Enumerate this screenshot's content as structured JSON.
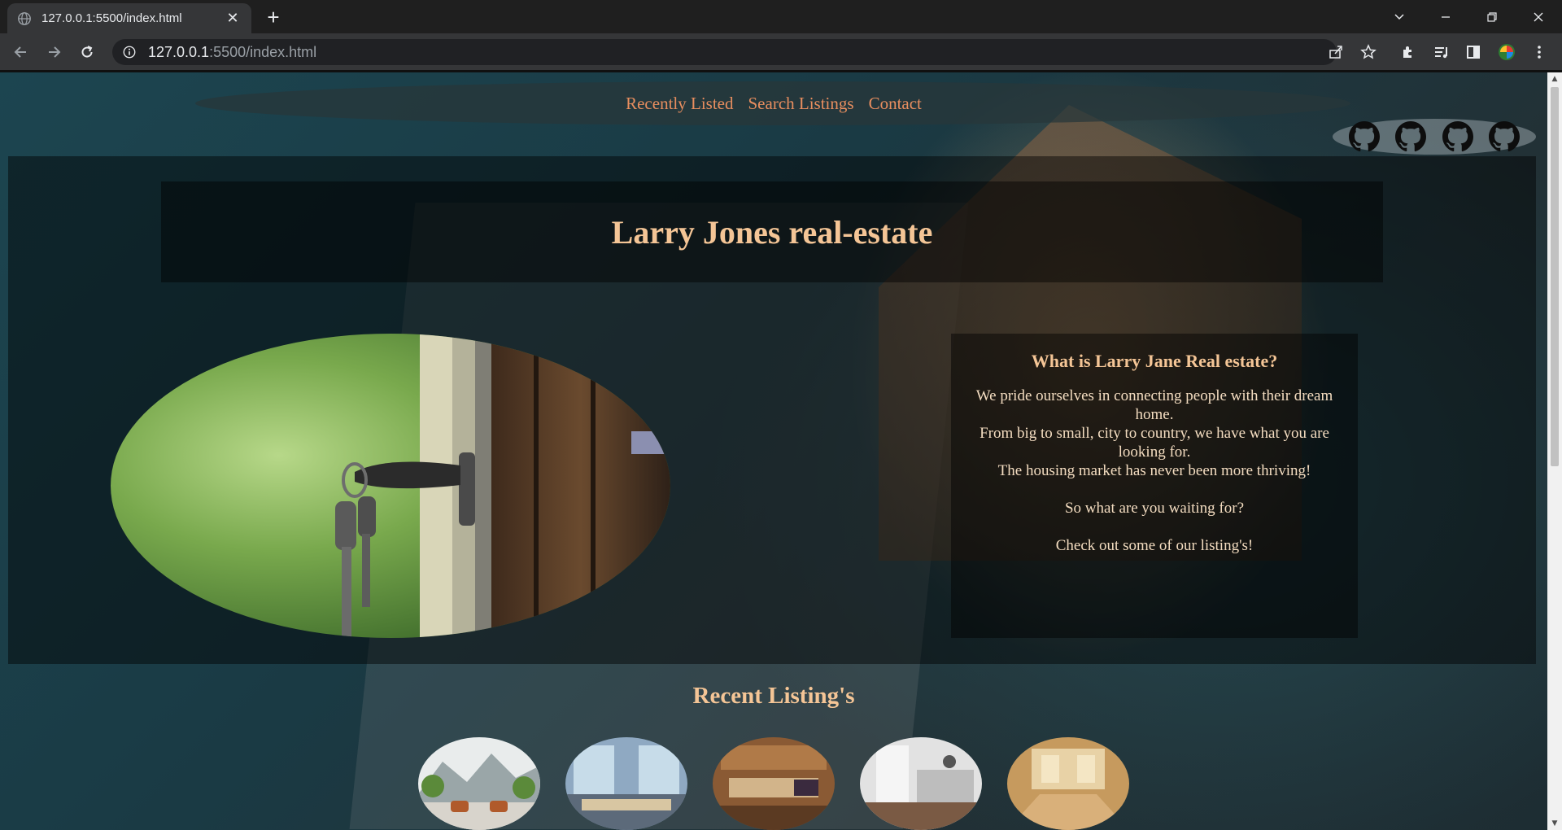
{
  "browser": {
    "tab_title": "127.0.0.1:5500/index.html",
    "url_host": "127.0.0.1",
    "url_rest": ":5500/index.html",
    "new_tab_glyph": "+",
    "close_glyph": "✕"
  },
  "nav": {
    "links": [
      "Recently Listed",
      "Search Listings",
      "Contact"
    ]
  },
  "social": {
    "icons": [
      "github-icon",
      "github-icon",
      "github-icon",
      "github-icon"
    ]
  },
  "hero": {
    "title": "Larry Jones real-estate"
  },
  "about": {
    "heading": "What is Larry Jane Real estate?",
    "line1": "We pride ourselves in connecting people with their dream home.",
    "line2": "From big to small, city to country, we have what you are looking for.",
    "line3": "The housing market has never been more thriving!",
    "line4": "So what are you waiting for?",
    "line5": "Check out some of our listing's!"
  },
  "recent": {
    "title": "Recent Listing's"
  },
  "colors": {
    "nav_link": "#e88e5f",
    "title": "#f4c596",
    "body_text": "#f3dcc0"
  }
}
